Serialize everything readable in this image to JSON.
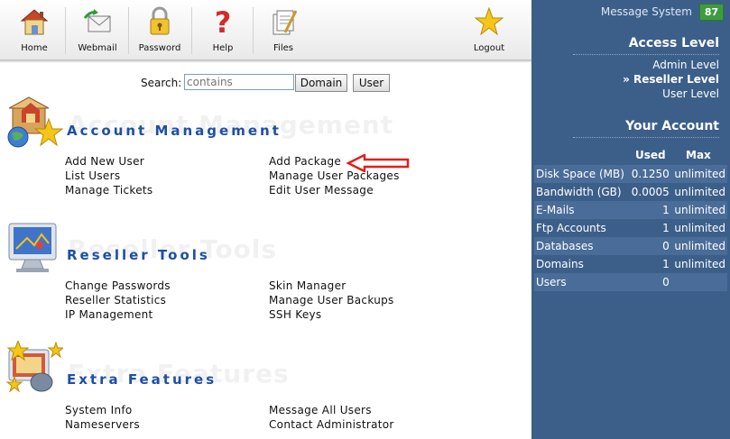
{
  "toolbar": {
    "items": [
      {
        "label": "Home",
        "icon": "home-icon"
      },
      {
        "label": "Webmail",
        "icon": "webmail-icon"
      },
      {
        "label": "Password",
        "icon": "padlock-icon"
      },
      {
        "label": "Help",
        "icon": "question-mark-icon"
      },
      {
        "label": "Files",
        "icon": "files-icon"
      },
      {
        "label": "Logout",
        "icon": "star-icon"
      }
    ]
  },
  "search": {
    "label": "Search:",
    "placeholder": "contains",
    "domain_button": "Domain",
    "user_button": "User"
  },
  "sections": {
    "account": {
      "title": "Account Management",
      "ghost": "Account Management",
      "links": [
        "Add New User",
        "List Users",
        "Manage Tickets",
        "Add Package",
        "Manage User Packages",
        "Edit User Message"
      ]
    },
    "reseller": {
      "title": "Reseller Tools",
      "ghost": "Reseller Tools",
      "links": [
        "Change Passwords",
        "Reseller Statistics",
        "IP Management",
        "Skin Manager",
        "Manage User Backups",
        "SSH Keys"
      ]
    },
    "extra": {
      "title": "Extra Features",
      "ghost": "Extra Features",
      "links": [
        "System Info",
        "Nameservers",
        "Message All Users",
        "Contact Administrator"
      ]
    }
  },
  "sidebar": {
    "message_system": {
      "label": "Message System",
      "count": "87"
    },
    "access_level": {
      "title": "Access Level",
      "levels": [
        "Admin Level",
        "» Reseller Level",
        "User Level"
      ]
    },
    "your_account": {
      "title": "Your Account",
      "headers": {
        "used": "Used",
        "max": "Max"
      },
      "rows": [
        {
          "name": "Disk Space (MB)",
          "used": "0.1250",
          "max": "unlimited"
        },
        {
          "name": "Bandwidth (GB)",
          "used": "0.0005",
          "max": "unlimited"
        },
        {
          "name": "E-Mails",
          "used": "1",
          "max": "unlimited"
        },
        {
          "name": "Ftp Accounts",
          "used": "1",
          "max": "unlimited"
        },
        {
          "name": "Databases",
          "used": "0",
          "max": "unlimited"
        },
        {
          "name": "Domains",
          "used": "1",
          "max": "unlimited"
        },
        {
          "name": "Users",
          "used": "0",
          "max": ""
        }
      ]
    }
  },
  "colors": {
    "sidebar_bg": "#3c5f8a",
    "section_title": "#1d4fa5",
    "badge": "#3f9b3f",
    "annotation_arrow": "#e0201c"
  }
}
